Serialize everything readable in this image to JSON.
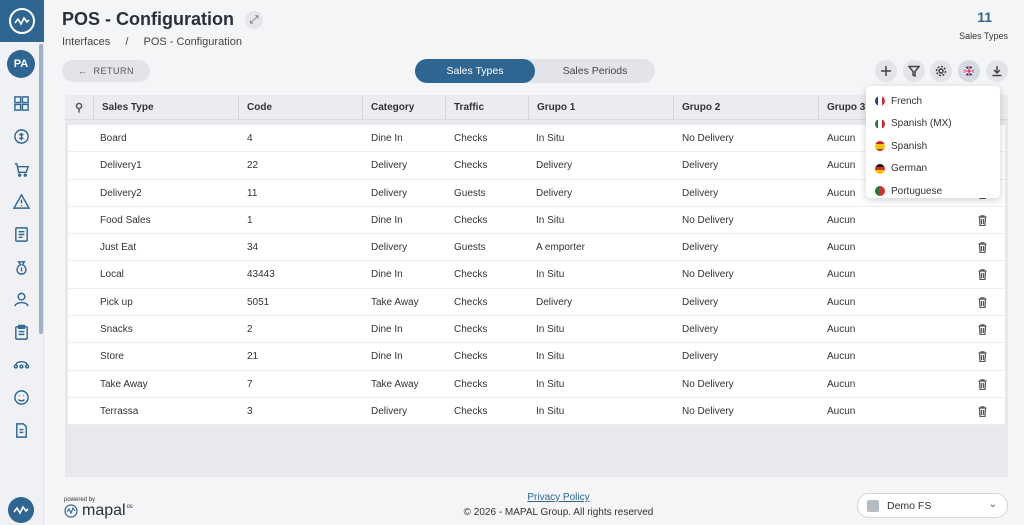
{
  "header": {
    "title": "POS - Configuration",
    "breadcrumb": [
      "Interfaces",
      "/",
      "POS - Configuration"
    ],
    "count": "11",
    "count_label": "Sales Types"
  },
  "toolbar": {
    "return_label": "RETURN",
    "tabs": [
      {
        "label": "Sales Types",
        "active": true
      },
      {
        "label": "Sales Periods",
        "active": false
      }
    ],
    "icons": [
      "plus-icon",
      "filter-icon",
      "settings-icon",
      "flag-uk-icon",
      "download-icon"
    ]
  },
  "table": {
    "columns": [
      "Sales Type",
      "Code",
      "Category",
      "Traffic",
      "Grupo 1",
      "Grupo 2",
      "Grupo 3"
    ],
    "rows": [
      [
        "Board",
        "4",
        "Dine In",
        "Checks",
        "In Situ",
        "No Delivery",
        "Aucun"
      ],
      [
        "Delivery1",
        "22",
        "Delivery",
        "Checks",
        "Delivery",
        "Delivery",
        "Aucun"
      ],
      [
        "Delivery2",
        "11",
        "Delivery",
        "Guests",
        "Delivery",
        "Delivery",
        "Aucun"
      ],
      [
        "Food Sales",
        "1",
        "Dine In",
        "Checks",
        "In Situ",
        "No Delivery",
        "Aucun"
      ],
      [
        "Just Eat",
        "34",
        "Delivery",
        "Guests",
        "A emporter",
        "Delivery",
        "Aucun"
      ],
      [
        "Local",
        "43443",
        "Dine In",
        "Checks",
        "In Situ",
        "No Delivery",
        "Aucun"
      ],
      [
        "Pick up",
        "5051",
        "Take Away",
        "Checks",
        "Delivery",
        "Delivery",
        "Aucun"
      ],
      [
        "Snacks",
        "2",
        "Dine In",
        "Checks",
        "In Situ",
        "Delivery",
        "Aucun"
      ],
      [
        "Store",
        "21",
        "Dine In",
        "Checks",
        "In Situ",
        "Delivery",
        "Aucun"
      ],
      [
        "Take Away",
        "7",
        "Take Away",
        "Checks",
        "In Situ",
        "No Delivery",
        "Aucun"
      ],
      [
        "Terrassa",
        "3",
        "Delivery",
        "Checks",
        "In Situ",
        "No Delivery",
        "Aucun"
      ]
    ]
  },
  "language_menu": {
    "items": [
      {
        "label": "French",
        "flag": "fr"
      },
      {
        "label": "Spanish (MX)",
        "flag": "mx"
      },
      {
        "label": "Spanish",
        "flag": "es"
      },
      {
        "label": "German",
        "flag": "de"
      },
      {
        "label": "Portuguese",
        "flag": "pt"
      }
    ]
  },
  "sidebar": {
    "avatar": "PA",
    "icons": [
      "dashboard-icon",
      "sales-icon",
      "cart-icon",
      "alert-icon",
      "report-icon",
      "money-bag-icon",
      "user-icon",
      "clipboard-icon",
      "integration-icon",
      "smiley-icon",
      "document-icon"
    ]
  },
  "footer": {
    "powered_by": "powered by",
    "brand": "mapal",
    "brand_suffix": "os",
    "privacy": "Privacy Policy",
    "copyright": "© 2026 - MAPAL Group. All rights reserved",
    "company": "Demo FS"
  },
  "colors": {
    "primary": "#2e6591",
    "background": "#f4f5f7"
  }
}
